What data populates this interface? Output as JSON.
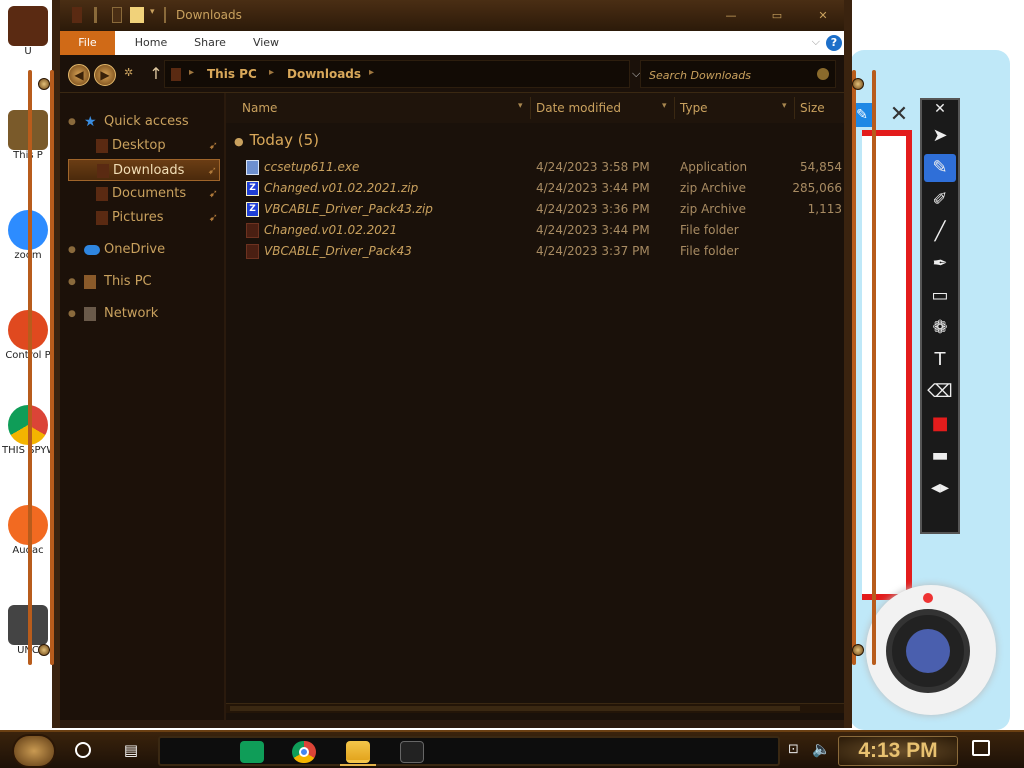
{
  "window": {
    "title": "Downloads",
    "minimize_label": "—",
    "maximize_label": "▭",
    "close_label": "✕"
  },
  "ribbon": {
    "tabs": [
      "File",
      "Home",
      "Share",
      "View"
    ]
  },
  "address": {
    "crumbs": [
      "This PC",
      "Downloads"
    ],
    "search_placeholder": "Search Downloads"
  },
  "nav": {
    "quick_access": "Quick access",
    "pinned": [
      "Desktop",
      "Downloads",
      "Documents",
      "Pictures"
    ],
    "selected": "Downloads",
    "onedrive": "OneDrive",
    "this_pc": "This PC",
    "network": "Network"
  },
  "columns": {
    "name": "Name",
    "date": "Date modified",
    "type": "Type",
    "size": "Size"
  },
  "group": {
    "label": "Today (5)"
  },
  "files": [
    {
      "name": "ccsetup611.exe",
      "date": "4/24/2023 3:58 PM",
      "type": "Application",
      "size": "54,854",
      "icon": "exe-icon"
    },
    {
      "name": "Changed.v01.02.2021.zip",
      "date": "4/24/2023 3:44 PM",
      "type": "zip Archive",
      "size": "285,066",
      "icon": "zip-icon"
    },
    {
      "name": "VBCABLE_Driver_Pack43.zip",
      "date": "4/24/2023 3:36 PM",
      "type": "zip Archive",
      "size": "1,113",
      "icon": "zip-icon"
    },
    {
      "name": "Changed.v01.02.2021",
      "date": "4/24/2023 3:44 PM",
      "type": "File folder",
      "size": "",
      "icon": "folder-icon"
    },
    {
      "name": "VBCABLE_Driver_Pack43",
      "date": "4/24/2023 3:37 PM",
      "type": "File folder",
      "size": "",
      "icon": "folder-icon"
    }
  ],
  "desktop_icons": [
    {
      "caption": "U"
    },
    {
      "caption": "This P"
    },
    {
      "caption": "zoom"
    },
    {
      "caption": "Control P"
    },
    {
      "caption": "THIS SPYWA"
    },
    {
      "caption": "Audac"
    },
    {
      "caption": "UNC"
    }
  ],
  "taskbar": {
    "clock": "4:13 PM"
  },
  "colors": {
    "accent": "#d06a17",
    "text_gold": "#c9a15e",
    "window_bg": "#1a110a"
  }
}
